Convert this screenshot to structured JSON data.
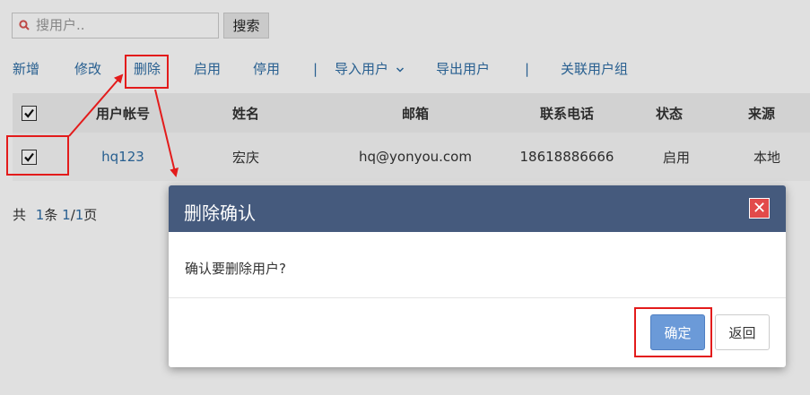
{
  "search": {
    "placeholder": "搜用户..",
    "button_label": "搜索"
  },
  "toolbar": {
    "add": "新增",
    "edit": "修改",
    "delete": "删除",
    "enable": "启用",
    "disable": "停用",
    "separator": "|",
    "import": "导入用户",
    "export": "导出用户",
    "link_group": "关联用户组"
  },
  "table": {
    "headers": [
      "用户帐号",
      "姓名",
      "邮箱",
      "联系电话",
      "状态",
      "来源"
    ],
    "rows": [
      {
        "account": "hq123",
        "name": "宏庆",
        "email": "hq@yonyou.com",
        "phone": "18618886666",
        "status": "启用",
        "source": "本地"
      }
    ]
  },
  "pagination": {
    "prefix": "共",
    "total": "1",
    "unit": "条",
    "page": "1",
    "slash": "/",
    "pages": "1",
    "suffix": "页"
  },
  "dialog": {
    "title": "删除确认",
    "close": "✕",
    "message": "确认要删除用户?",
    "ok_label": "确定",
    "back_label": "返回"
  },
  "colors": {
    "accent": "#455a7d",
    "link": "#2e6da4",
    "highlight": "#e31b1b",
    "primary_button": "#6b9ad8",
    "close_button": "#e24a4a"
  }
}
